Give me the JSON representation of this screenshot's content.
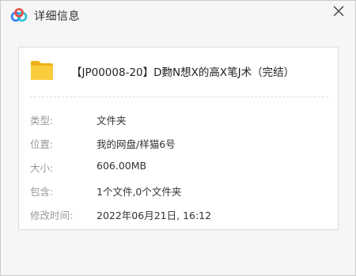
{
  "dialog": {
    "title": "详细信息",
    "close_icon": "close-icon",
    "logo_icon": "baidu-netdisk-logo"
  },
  "file": {
    "icon": "folder-icon",
    "name": "【JP00008-20】D覅N想X的高X笔J术（完结）"
  },
  "details": [
    {
      "label": "类型:",
      "value": "文件夹"
    },
    {
      "label": "位置:",
      "value": "我的网盘/样猫6号"
    },
    {
      "label": "大小:",
      "value": "606.00MB"
    },
    {
      "label": "包含:",
      "value": "1个文件,0个文件夹"
    },
    {
      "label": "修改时间:",
      "value": "2022年06月21日, 16:12"
    }
  ],
  "colors": {
    "dialog_bg": "#f6f6f6",
    "panel_bg": "#ffffff",
    "folder": "#f5c12f",
    "logo_blue": "#2f7cf6",
    "logo_red": "#ea4a41",
    "logo_teal": "#29c2d8",
    "label_gray": "#999999"
  }
}
